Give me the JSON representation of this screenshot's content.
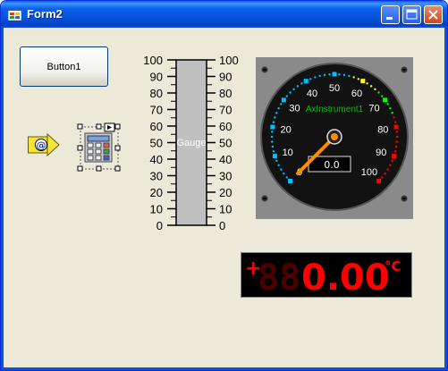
{
  "window": {
    "title": "Form2",
    "buttons": [
      "minimize",
      "maximize",
      "close"
    ]
  },
  "button1": {
    "label": "Button1"
  },
  "icons": {
    "component_left": "arrow-at-icon",
    "component_selected": "calculator-grid-icon"
  },
  "gauge": {
    "label": "Gauge",
    "min": 0,
    "max": 100,
    "ticks": [
      0,
      10,
      20,
      30,
      40,
      50,
      60,
      70,
      80,
      90,
      100
    ],
    "ticks_left": [
      "100",
      "90",
      "80",
      "70",
      "60",
      "50",
      "40",
      "30",
      "20",
      "10",
      "0"
    ],
    "ticks_right": [
      "100",
      "90",
      "80",
      "70",
      "60",
      "50",
      "40",
      "30",
      "20",
      "10",
      "0"
    ],
    "value": 100
  },
  "instrument": {
    "name": "AxInstrument1",
    "scale_labels": [
      "0",
      "10",
      "20",
      "30",
      "40",
      "50",
      "60",
      "70",
      "80",
      "90",
      "100"
    ],
    "readout": "0.0",
    "value": 0,
    "colors": {
      "scale": "#00BFFF",
      "warn": "#FFFF00",
      "ok": "#00FF00",
      "danger": "#FF0000",
      "needle": "#FF8C00"
    }
  },
  "led_display": {
    "sign": "+",
    "dim_digits": "88",
    "value": "0.00",
    "unit": "°C",
    "color": "#FF0000",
    "dim_color": "#4A0000"
  }
}
